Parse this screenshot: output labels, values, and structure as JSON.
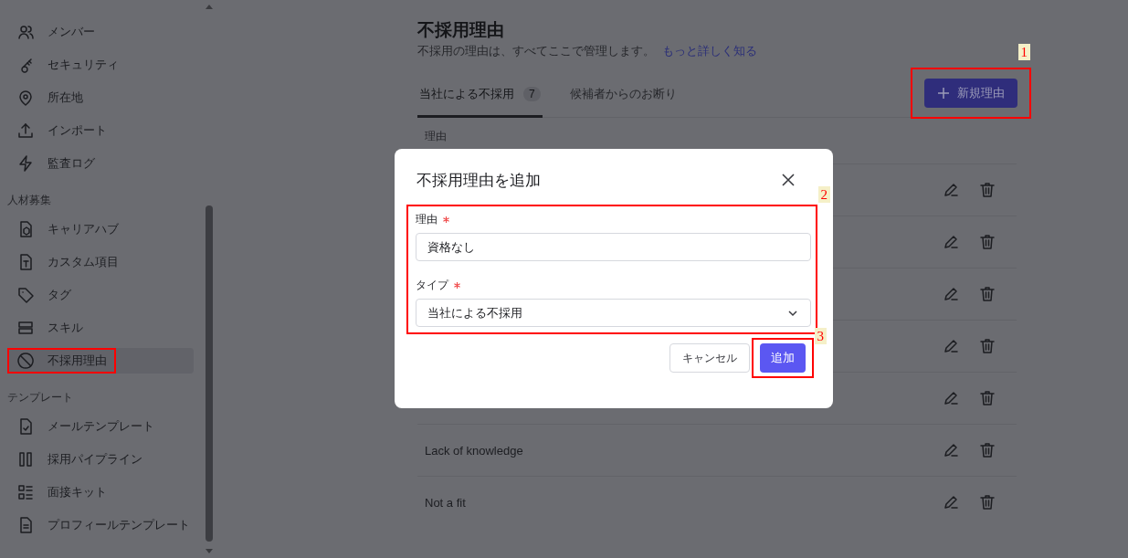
{
  "sidebar": {
    "sections": [
      {
        "items": [
          {
            "label": "メンバー",
            "selected": false
          },
          {
            "label": "セキュリティ",
            "selected": false
          },
          {
            "label": "所在地",
            "selected": false
          },
          {
            "label": "インポート",
            "selected": false
          },
          {
            "label": "監査ログ",
            "selected": false
          }
        ]
      },
      {
        "heading": "人材募集",
        "items": [
          {
            "label": "キャリアハブ",
            "selected": false
          },
          {
            "label": "カスタム項目",
            "selected": false
          },
          {
            "label": "タグ",
            "selected": false
          },
          {
            "label": "スキル",
            "selected": false
          },
          {
            "label": "不採用理由",
            "selected": true
          }
        ]
      },
      {
        "heading": "テンプレート",
        "items": [
          {
            "label": "メールテンプレート",
            "selected": false
          },
          {
            "label": "採用パイプライン",
            "selected": false
          },
          {
            "label": "面接キット",
            "selected": false
          },
          {
            "label": "プロフィールテンプレート",
            "selected": false
          }
        ]
      }
    ]
  },
  "page": {
    "title": "不採用理由",
    "description": "不採用の理由は、すべてここで管理します。",
    "learn_more_link": "もっと詳しく知る",
    "new_button": "新規理由"
  },
  "tabs": [
    {
      "label": "当社による不採用",
      "count": "7",
      "selected": true
    },
    {
      "label": "候補者からのお断り",
      "selected": false
    }
  ],
  "table": {
    "columns": [
      "理由"
    ],
    "rows": [
      {
        "kind": "covered"
      },
      {
        "kind": "covered"
      },
      {
        "kind": "covered"
      },
      {
        "kind": "covered"
      },
      {
        "kind": "covered"
      },
      {
        "kind": "text",
        "name": "Lack of knowledge"
      },
      {
        "kind": "text",
        "name": "Not a fit"
      }
    ]
  },
  "dialog": {
    "title": "不採用理由を追加",
    "fields": [
      {
        "kind": "text",
        "label": "理由",
        "required": true,
        "value": "資格なし"
      },
      {
        "kind": "select",
        "label": "タイプ",
        "required": true,
        "value": "当社による不採用"
      }
    ],
    "cancel_button": "キャンセル",
    "submit_button": "追加"
  },
  "annotations": {
    "sidebar_selected": {
      "outlined": true
    },
    "new_button": {
      "label": "1"
    },
    "dialog_fields": {
      "label": "2"
    },
    "submit_button": {
      "label": "3"
    }
  }
}
